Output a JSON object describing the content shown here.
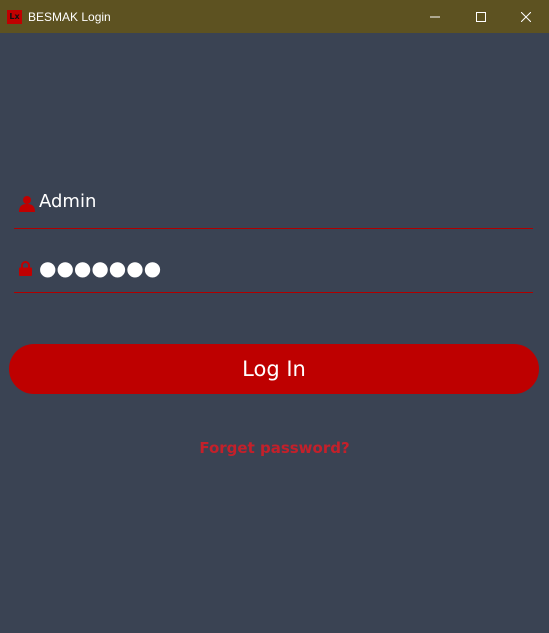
{
  "window": {
    "icon_text": "Lx",
    "title": "BESMAK Login"
  },
  "form": {
    "username": {
      "value": "Admin",
      "icon": "user-icon"
    },
    "password": {
      "value": "●●●●●●●",
      "icon": "lock-icon"
    },
    "login_label": "Log In",
    "forgot_label": "Forget password?"
  },
  "colors": {
    "background": "#3a4353",
    "titlebar": "#5d5221",
    "accent": "#be0000",
    "link": "#c4202a"
  }
}
